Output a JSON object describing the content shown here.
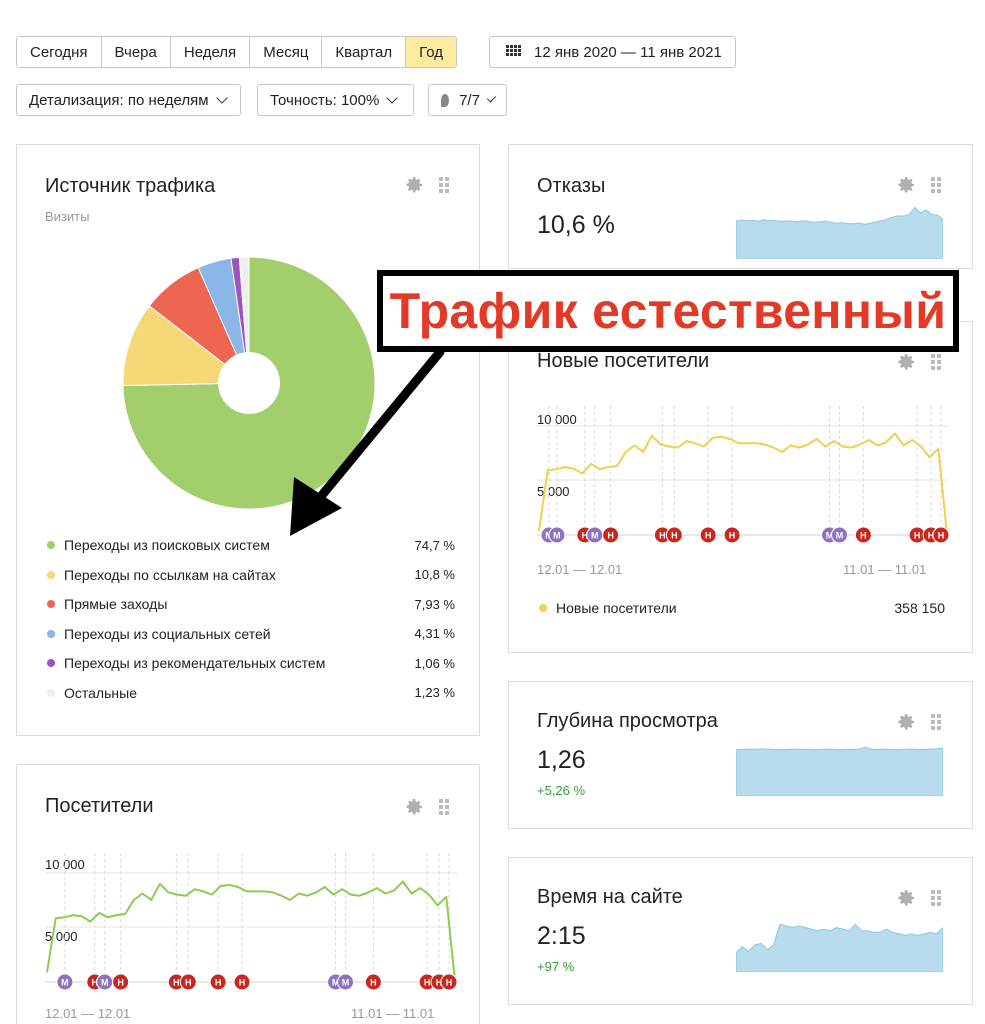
{
  "periods": [
    {
      "label": "Сегодня",
      "active": false
    },
    {
      "label": "Вчера",
      "active": false
    },
    {
      "label": "Неделя",
      "active": false
    },
    {
      "label": "Месяц",
      "active": false
    },
    {
      "label": "Квартал",
      "active": false
    },
    {
      "label": "Год",
      "active": true
    }
  ],
  "date_range": "12 янв 2020 — 11 янв 2021",
  "filters": {
    "detail": "Детализация: по неделям",
    "accuracy": "Точность: 100%",
    "notes": "7/7"
  },
  "colors": {
    "search": "#a2ce6b",
    "links": "#f6d878",
    "direct": "#ec6651",
    "social": "#8ab6e8",
    "recommend": "#9b55c0",
    "other": "#eeeeee",
    "spark_fill": "#b6dcee",
    "new_visitors_line": "#f3cf4e",
    "visitors_line": "#8ccc55",
    "marker_red": "#c8261f",
    "marker_purple": "#8c72bf",
    "positive": "#3a9d3a",
    "callout": "#e23a26"
  },
  "traffic": {
    "title": "Источник трафика",
    "subtitle": "Визиты",
    "chart_data": {
      "type": "pie",
      "categories": [
        "Переходы из поисковых систем",
        "Переходы по ссылкам на сайтах",
        "Прямые заходы",
        "Переходы из социальных сетей",
        "Переходы из рекомендательных систем",
        "Остальные"
      ],
      "values": [
        74.7,
        10.8,
        7.93,
        4.31,
        1.06,
        1.23
      ]
    },
    "legend": [
      {
        "label": "Переходы из поисковых систем",
        "pct": "74,7 %",
        "color": "#a2ce6b"
      },
      {
        "label": "Переходы по ссылкам на сайтах",
        "pct": "10,8 %",
        "color": "#f6d878"
      },
      {
        "label": "Прямые заходы",
        "pct": "7,93 %",
        "color": "#ec6651"
      },
      {
        "label": "Переходы из социальных сетей",
        "pct": "4,31 %",
        "color": "#8ab6e8"
      },
      {
        "label": "Переходы из рекомендательных систем",
        "pct": "1,06 %",
        "color": "#9b55c0"
      },
      {
        "label": "Остальные",
        "pct": "1,23 %",
        "color": "#eeeeee"
      }
    ]
  },
  "bounces": {
    "title": "Отказы",
    "value": "10,6 %"
  },
  "new_visitors": {
    "title": "Новые посетители",
    "y_top": "10 000",
    "y_mid": "5 000",
    "date_left": "12.01 — 12.01",
    "date_right": "11.01 — 11.01",
    "legend_label": "Новые посетители",
    "total": "358 150",
    "markers": [
      {
        "k": "M",
        "c": "purple",
        "x": 0.015
      },
      {
        "k": "M",
        "c": "purple",
        "x": 0.035
      },
      {
        "k": "H",
        "c": "red",
        "x": 0.105
      },
      {
        "k": "M",
        "c": "purple",
        "x": 0.13
      },
      {
        "k": "H",
        "c": "red",
        "x": 0.17
      },
      {
        "k": "H",
        "c": "red",
        "x": 0.3
      },
      {
        "k": "H",
        "c": "red",
        "x": 0.33
      },
      {
        "k": "H",
        "c": "red",
        "x": 0.415
      },
      {
        "k": "H",
        "c": "red",
        "x": 0.475
      },
      {
        "k": "M",
        "c": "purple",
        "x": 0.72
      },
      {
        "k": "M",
        "c": "purple",
        "x": 0.745
      },
      {
        "k": "H",
        "c": "red",
        "x": 0.805
      },
      {
        "k": "H",
        "c": "red",
        "x": 0.94
      },
      {
        "k": "H",
        "c": "red",
        "x": 0.975
      },
      {
        "k": "H",
        "c": "red",
        "x": 1.0
      }
    ],
    "chart_data": {
      "type": "line",
      "series": [
        {
          "name": "Новые посетители",
          "values": [
            300,
            5900,
            6000,
            6200,
            6050,
            5600,
            6500,
            6000,
            6200,
            6300,
            7600,
            8200,
            7600,
            9100,
            8300,
            8100,
            8000,
            8600,
            8400,
            8100,
            8900,
            9000,
            8800,
            8400,
            8400,
            8400,
            8300,
            8000,
            7600,
            8200,
            8000,
            8300,
            8800,
            8100,
            8600,
            8100,
            8000,
            8300,
            8700,
            8200,
            8500,
            9300,
            8200,
            8700,
            8100,
            7100,
            7900,
            0
          ]
        }
      ],
      "ylim": [
        0,
        12000
      ]
    }
  },
  "depth": {
    "title": "Глубина просмотра",
    "value": "1,26",
    "delta": "+5,26 %"
  },
  "time": {
    "title": "Время на сайте",
    "value": "2:15",
    "delta": "+97 %"
  },
  "visitors": {
    "title": "Посетители",
    "y_top": "10 000",
    "y_mid": "5 000",
    "date_left": "12.01 — 12.01",
    "date_right": "11.01 — 11.01",
    "markers": [
      {
        "k": "M",
        "c": "purple",
        "x": 0.035
      },
      {
        "k": "H",
        "c": "red",
        "x": 0.11
      },
      {
        "k": "M",
        "c": "purple",
        "x": 0.135
      },
      {
        "k": "H",
        "c": "red",
        "x": 0.175
      },
      {
        "k": "H",
        "c": "red",
        "x": 0.315
      },
      {
        "k": "H",
        "c": "red",
        "x": 0.345
      },
      {
        "k": "H",
        "c": "red",
        "x": 0.42
      },
      {
        "k": "H",
        "c": "red",
        "x": 0.48
      },
      {
        "k": "M",
        "c": "purple",
        "x": 0.715
      },
      {
        "k": "M",
        "c": "purple",
        "x": 0.74
      },
      {
        "k": "H",
        "c": "red",
        "x": 0.81
      },
      {
        "k": "H",
        "c": "red",
        "x": 0.945
      },
      {
        "k": "H",
        "c": "red",
        "x": 0.975
      },
      {
        "k": "H",
        "c": "red",
        "x": 1.0
      }
    ],
    "chart_data": {
      "type": "line",
      "series": [
        {
          "name": "Посетители",
          "values": [
            800,
            5800,
            5900,
            6100,
            6000,
            5500,
            6300,
            5900,
            6100,
            6200,
            7500,
            8100,
            7500,
            9000,
            8200,
            8000,
            7900,
            8500,
            8300,
            8000,
            8800,
            8900,
            8700,
            8300,
            8300,
            8300,
            8200,
            7900,
            7500,
            8100,
            7900,
            8200,
            8700,
            8000,
            8500,
            8000,
            7900,
            8200,
            8600,
            8100,
            8400,
            9200,
            8100,
            8600,
            8000,
            7000,
            7800,
            0
          ]
        }
      ],
      "ylim": [
        0,
        12000
      ]
    }
  },
  "sparks": {
    "bounces": [
      9.8,
      10.1,
      9.9,
      10.0,
      9.8,
      10.2,
      9.9,
      10.0,
      9.7,
      9.9,
      9.8,
      9.6,
      9.9,
      9.7,
      9.5,
      9.6,
      9.8,
      9.5,
      9.3,
      9.4,
      9.2,
      9.1,
      9.3,
      9.0,
      9.3,
      9.6,
      9.9,
      10.3,
      10.8,
      11.2,
      11.1,
      11.6,
      13.3,
      11.9,
      12.7,
      11.5,
      11.4,
      10.2
    ],
    "depth": [
      1.24,
      1.25,
      1.26,
      1.25,
      1.27,
      1.26,
      1.25,
      1.24,
      1.25,
      1.26,
      1.25,
      1.25,
      1.24,
      1.25,
      1.26,
      1.25,
      1.24,
      1.25,
      1.25,
      1.26,
      1.31,
      1.25,
      1.25,
      1.26,
      1.25,
      1.24,
      1.25,
      1.26,
      1.25,
      1.25,
      1.26,
      1.27,
      1.28
    ],
    "time": [
      1.2,
      1.6,
      1.3,
      1.7,
      1.8,
      1.4,
      1.7,
      3.0,
      2.9,
      2.8,
      2.9,
      2.8,
      2.7,
      2.6,
      2.7,
      2.6,
      2.8,
      2.7,
      2.6,
      3.0,
      2.6,
      2.6,
      2.5,
      2.5,
      2.7,
      2.5,
      2.4,
      2.3,
      2.4,
      2.3,
      2.4,
      2.5,
      2.4,
      2.8
    ]
  },
  "callout": {
    "text": "Трафик естественный"
  }
}
